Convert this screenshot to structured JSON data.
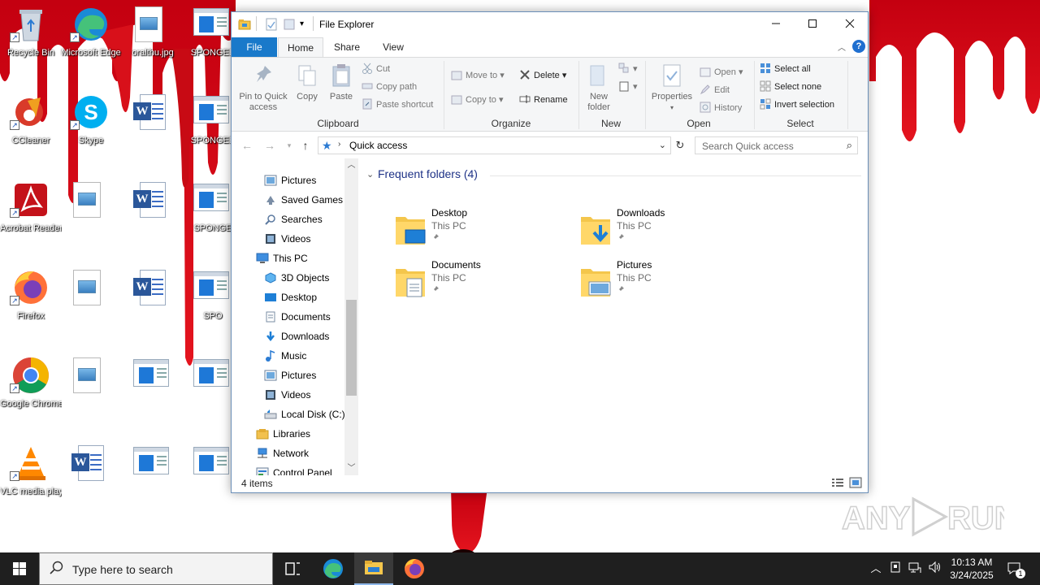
{
  "desktop": {
    "icons": [
      {
        "label": "Recycle Bin",
        "icon": "recycle-bin-icon"
      },
      {
        "label": "Microsoft Edge",
        "icon": "edge-icon"
      },
      {
        "label": "oralthu.jpg",
        "icon": "image-file-icon"
      },
      {
        "label": "SPONGEB",
        "icon": "window-file-icon"
      },
      {
        "label": "CCleaner",
        "icon": "ccleaner-icon"
      },
      {
        "label": "Skype",
        "icon": "skype-icon"
      },
      {
        "label": "",
        "icon": "word-document-icon"
      },
      {
        "label": "SPONGEB",
        "icon": "window-file-icon"
      },
      {
        "label": "Acrobat Reader",
        "icon": "acrobat-icon"
      },
      {
        "label": "",
        "icon": "image-file-icon"
      },
      {
        "label": "",
        "icon": "word-document-icon"
      },
      {
        "label": "SPONGE",
        "icon": "window-file-icon"
      },
      {
        "label": "Firefox",
        "icon": "firefox-icon"
      },
      {
        "label": "",
        "icon": "image-file-icon"
      },
      {
        "label": "",
        "icon": "word-document-icon"
      },
      {
        "label": "SPO",
        "icon": "window-file-icon"
      },
      {
        "label": "Google Chrome",
        "icon": "chrome-icon"
      },
      {
        "label": "",
        "icon": "image-file-icon"
      },
      {
        "label": "",
        "icon": "window-file-icon"
      },
      {
        "label": "",
        "icon": "window-file-icon"
      },
      {
        "label": "VLC media player",
        "icon": "vlc-icon"
      },
      {
        "label": "",
        "icon": "word-document-icon"
      },
      {
        "label": "",
        "icon": "window-file-icon"
      },
      {
        "label": "",
        "icon": "window-file-icon"
      }
    ]
  },
  "explorer": {
    "title": "File Explorer",
    "window_buttons": {
      "minimize": "—",
      "maximize": "☐",
      "close": "✕"
    },
    "tabs": [
      {
        "label": "File"
      },
      {
        "label": "Home"
      },
      {
        "label": "Share"
      },
      {
        "label": "View"
      }
    ],
    "ribbon": {
      "clipboard": {
        "label": "Clipboard",
        "pin": "Pin to Quick access",
        "pin_line1": "Pin to Quick",
        "pin_line2": "access",
        "copy": "Copy",
        "paste": "Paste",
        "cut": "Cut",
        "copy_path": "Copy path",
        "paste_shortcut": "Paste shortcut"
      },
      "organize": {
        "label": "Organize",
        "move_to": "Move to",
        "copy_to": "Copy to",
        "delete": "Delete",
        "rename": "Rename"
      },
      "new": {
        "label": "New",
        "new_folder_line1": "New",
        "new_folder_line2": "folder"
      },
      "open": {
        "label": "Open",
        "properties": "Properties",
        "open": "Open",
        "edit": "Edit",
        "history": "History"
      },
      "select": {
        "label": "Select",
        "select_all": "Select all",
        "select_none": "Select none",
        "invert": "Invert selection"
      }
    },
    "address": {
      "path": "Quick access",
      "search_placeholder": "Search Quick access"
    },
    "nav_pane": [
      {
        "label": "Pictures",
        "icon": "pictures-icon",
        "indent": 1
      },
      {
        "label": "Saved Games",
        "icon": "saved-games-icon",
        "indent": 1
      },
      {
        "label": "Searches",
        "icon": "searches-icon",
        "indent": 1
      },
      {
        "label": "Videos",
        "icon": "videos-icon",
        "indent": 1
      },
      {
        "label": "This PC",
        "icon": "this-pc-icon",
        "indent": 0
      },
      {
        "label": "3D Objects",
        "icon": "3d-objects-icon",
        "indent": 1
      },
      {
        "label": "Desktop",
        "icon": "desktop-folder-icon",
        "indent": 1
      },
      {
        "label": "Documents",
        "icon": "documents-icon",
        "indent": 1
      },
      {
        "label": "Downloads",
        "icon": "downloads-icon",
        "indent": 1
      },
      {
        "label": "Music",
        "icon": "music-icon",
        "indent": 1
      },
      {
        "label": "Pictures",
        "icon": "pictures-icon",
        "indent": 1
      },
      {
        "label": "Videos",
        "icon": "videos-icon",
        "indent": 1
      },
      {
        "label": "Local Disk (C:)",
        "icon": "local-disk-icon",
        "indent": 1
      },
      {
        "label": "Libraries",
        "icon": "libraries-icon",
        "indent": 0
      },
      {
        "label": "Network",
        "icon": "network-icon",
        "indent": 0
      },
      {
        "label": "Control Panel",
        "icon": "control-panel-icon",
        "indent": 0
      }
    ],
    "content": {
      "section_title": "Frequent folders (4)",
      "folders": [
        {
          "name": "Desktop",
          "location": "This PC",
          "icon": "desktop-folder-icon"
        },
        {
          "name": "Downloads",
          "location": "This PC",
          "icon": "downloads-folder-icon"
        },
        {
          "name": "Documents",
          "location": "This PC",
          "icon": "documents-folder-icon"
        },
        {
          "name": "Pictures",
          "location": "This PC",
          "icon": "pictures-folder-icon"
        }
      ]
    },
    "status": "4 items"
  },
  "taskbar": {
    "search_placeholder": "Type here to search",
    "apps": [
      "task-view-icon",
      "edge-icon",
      "file-explorer-icon",
      "firefox-icon"
    ],
    "time": "10:13 AM",
    "date": "3/24/2025",
    "notification_count": "1"
  },
  "watermark": "ANY RUN"
}
